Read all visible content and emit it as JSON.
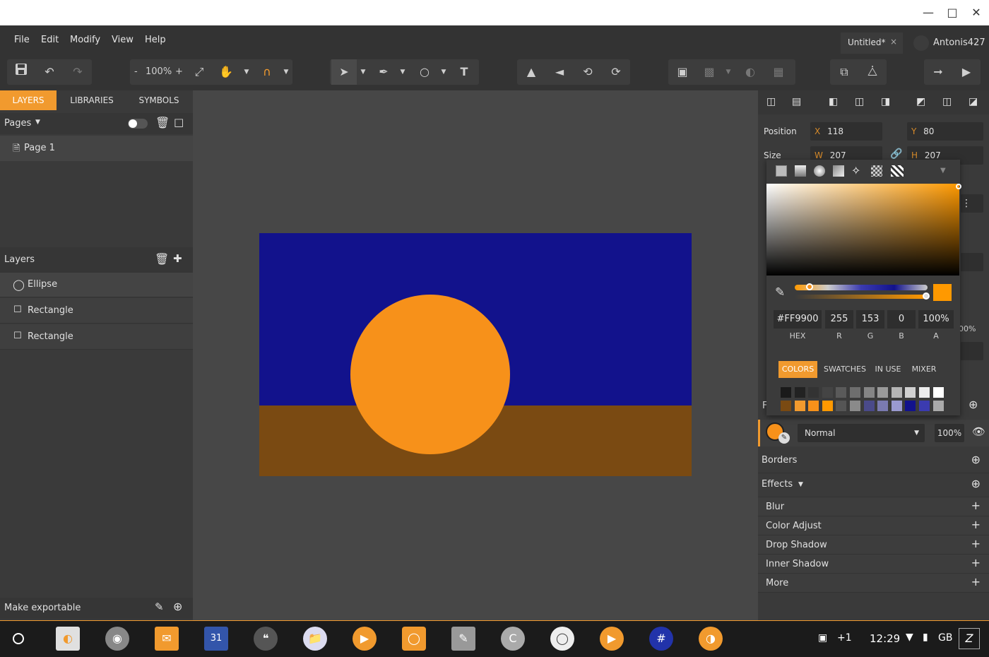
{
  "window": {
    "minimize_icon": "minimize-icon",
    "maximize_icon": "maximize-icon",
    "close_icon": "close-icon"
  },
  "menu": {
    "file": "File",
    "edit": "Edit",
    "modify": "Modify",
    "view": "View",
    "help": "Help"
  },
  "document": {
    "tab_title": "Untitled*",
    "close": "×",
    "user": "Antonis427"
  },
  "toolbar": {
    "zoom_minus": "-",
    "zoom": "100%",
    "zoom_plus": "+"
  },
  "left_tabs": {
    "layers": "LAYERS",
    "libraries": "LIBRARIES",
    "symbols": "SYMBOLS"
  },
  "pages": {
    "header": "Pages",
    "items": [
      {
        "label": "Page 1"
      }
    ]
  },
  "layers": {
    "header": "Layers",
    "items": [
      {
        "label": "Ellipse"
      },
      {
        "label": "Rectangle"
      },
      {
        "label": "Rectangle"
      }
    ]
  },
  "export": {
    "label": "Make exportable"
  },
  "artboard_colors": {
    "sky": "#12128c",
    "ground": "#7a4a12",
    "sun": "#f7911a"
  },
  "properties": {
    "position_label": "Position",
    "x_label": "X",
    "x": "118",
    "y_label": "Y",
    "y": "80",
    "size_label": "Size",
    "w_label": "W",
    "w": "207",
    "h_label": "H",
    "h": "207",
    "fill_mode": "Normal",
    "fill_opacity": "100%",
    "partial_opacity": "00%",
    "borders": "Borders",
    "effects": "Effects",
    "effect_items": [
      {
        "label": "Blur"
      },
      {
        "label": "Color Adjust"
      },
      {
        "label": "Drop Shadow"
      },
      {
        "label": "Inner Shadow"
      },
      {
        "label": "More"
      }
    ]
  },
  "picker": {
    "hex": "#FF9900",
    "r": "255",
    "g": "153",
    "b": "0",
    "a": "100%",
    "hex_label": "HEX",
    "r_label": "R",
    "g_label": "G",
    "b_label": "B",
    "a_label": "A",
    "tabs": {
      "colors": "COLORS",
      "swatches": "SWATCHES",
      "in_use": "IN USE",
      "mixer": "MIXER"
    },
    "swatches_row1": [
      "#1a1a1a",
      "#222222",
      "#333333",
      "#444444",
      "#5a5a5a",
      "#6e6e6e",
      "#858585",
      "#9a9a9a",
      "#b5b5b5",
      "#d0d0d0",
      "#ececec",
      "#ffffff"
    ],
    "swatches_row2": [
      "#7a4a12",
      "#f19a2e",
      "#f7911a",
      "#ff9900",
      "#555555",
      "#8a8a8a",
      "#4a4a8a",
      "#7a7ab0",
      "#9a9ad0",
      "#12128c",
      "#3b3bb0",
      "#aaaaaa"
    ]
  },
  "status": {
    "clock": "12:29",
    "notifications": "+1",
    "locale": "GB"
  }
}
